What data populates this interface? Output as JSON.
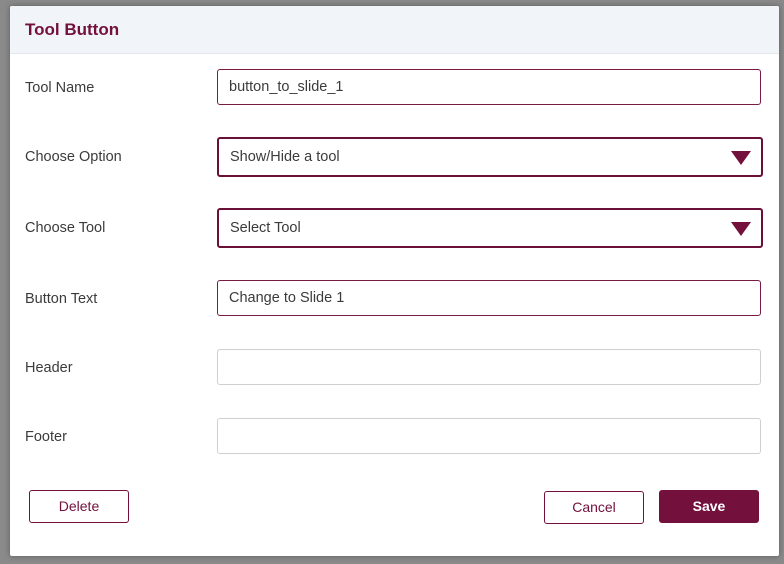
{
  "dialog": {
    "title": "Tool Button"
  },
  "form": {
    "tool_name": {
      "label": "Tool Name",
      "value": "button_to_slide_1"
    },
    "choose_option": {
      "label": "Choose Option",
      "selected": "Show/Hide a tool"
    },
    "choose_tool": {
      "label": "Choose Tool",
      "selected": "Select Tool"
    },
    "button_text": {
      "label": "Button Text",
      "value": "Change to Slide 1"
    },
    "header": {
      "label": "Header",
      "value": ""
    },
    "footer": {
      "label": "Footer",
      "value": ""
    }
  },
  "actions": {
    "delete_label": "Delete",
    "cancel_label": "Cancel",
    "save_label": "Save"
  },
  "colors": {
    "accent": "#73103c",
    "header_bg": "#f1f4f8",
    "overlay": "#8a8a8a"
  },
  "icons": {
    "dropdown": "caret-down-icon"
  }
}
